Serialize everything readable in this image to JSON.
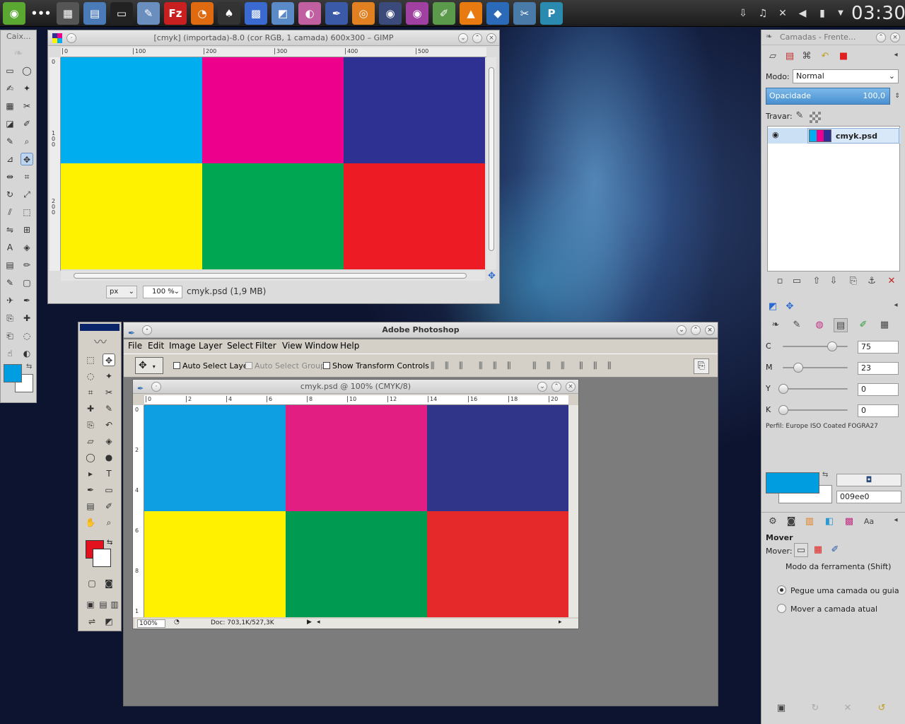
{
  "topbar": {
    "clock": "03:30",
    "launchers": [
      {
        "name": "opensuse-icon",
        "glyph": "◉",
        "color": "#5aa832"
      },
      {
        "name": "dots-icon",
        "glyph": "•••",
        "color": "transparent"
      },
      {
        "name": "window-switcher-icon",
        "glyph": "▦",
        "color": "#555"
      },
      {
        "name": "clipboard-icon",
        "glyph": "▤",
        "color": "#4a7ab8"
      },
      {
        "name": "terminal-icon",
        "glyph": "▭",
        "color": "#222"
      },
      {
        "name": "text-editor-icon",
        "glyph": "✎",
        "color": "#6a8fbf"
      },
      {
        "name": "filezilla-icon",
        "glyph": "Fz",
        "color": "#c82020"
      },
      {
        "name": "firefox-icon",
        "glyph": "◔",
        "color": "#e06a10"
      },
      {
        "name": "inkscape-icon",
        "glyph": "♠",
        "color": "#333"
      },
      {
        "name": "color-grid-icon",
        "glyph": "▩",
        "color": "#3a6ad0"
      },
      {
        "name": "image-viewer-icon",
        "glyph": "◩",
        "color": "#5a8ac8"
      },
      {
        "name": "paint-icon",
        "glyph": "◐",
        "color": "#c060a0"
      },
      {
        "name": "draw-icon",
        "glyph": "✒",
        "color": "#3a5aa8"
      },
      {
        "name": "blender-icon",
        "glyph": "◎",
        "color": "#e08020"
      },
      {
        "name": "camera-icon",
        "glyph": "◉",
        "color": "#3a4a7a"
      },
      {
        "name": "eye-icon",
        "glyph": "◉",
        "color": "#a040a0"
      },
      {
        "name": "pen-icon",
        "glyph": "✐",
        "color": "#5a9a4a"
      },
      {
        "name": "vlc-icon",
        "glyph": "▲",
        "color": "#e87a10"
      },
      {
        "name": "navigator-icon",
        "glyph": "◆",
        "color": "#2a6ab8"
      },
      {
        "name": "tools-icon",
        "glyph": "✂",
        "color": "#4a7aa8"
      },
      {
        "name": "photoshop-icon",
        "glyph": "P",
        "color": "#2a8ab0"
      }
    ],
    "tray": [
      "download-icon",
      "music-icon",
      "network-icon",
      "volume-icon",
      "battery-icon",
      "chevron-down-icon"
    ]
  },
  "gimp_toolbox": {
    "title": "Caix..."
  },
  "gimp_image": {
    "title": "[cmyk] (importada)-8.0 (cor RGB, 1 camada) 600x300 – GIMP",
    "ruler_ticks": [
      "0",
      "100",
      "200",
      "300",
      "400",
      "500"
    ],
    "unit": "px",
    "zoom": "100 %",
    "status": "cmyk.psd (1,9 MB)",
    "colors": [
      "#00aeef",
      "#ec008c",
      "#2e3192",
      "#fff200",
      "#00a651",
      "#ed1c24"
    ]
  },
  "photoshop": {
    "title": "Adobe Photoshop",
    "menu": [
      "File",
      "Edit",
      "Image",
      "Layer",
      "Select",
      "Filter",
      "View",
      "Window",
      "Help"
    ],
    "options": {
      "auto_select_layer": "Auto Select Layer",
      "auto_select_groups": "Auto Select Groups",
      "show_transform_controls": "Show Transform Controls"
    },
    "doc": {
      "title": "cmyk.psd @ 100% (CMYK/8)",
      "ruler_ticks": [
        "0",
        "2",
        "4",
        "6",
        "8",
        "10",
        "12",
        "14",
        "16",
        "18",
        "20"
      ],
      "v_ticks": [
        "0",
        "2",
        "4",
        "6",
        "8",
        "1"
      ],
      "zoom": "100%",
      "doc_size": "Doc: 703,1K/527,3K",
      "colors": [
        "#0d9fe2",
        "#e31e82",
        "#303589",
        "#fff100",
        "#009a51",
        "#e5282a"
      ]
    },
    "fg_color": "#e3101e"
  },
  "layers_dock": {
    "title": "Camadas - Frente...",
    "mode_label": "Modo:",
    "mode_value": "Normal",
    "opacity_label": "Opacidade",
    "opacity_value": "100,0",
    "lock_label": "Travar:",
    "layer_name": "cmyk.psd"
  },
  "color_dock": {
    "channels": [
      {
        "label": "C",
        "value": "75",
        "fraction": 0.75
      },
      {
        "label": "M",
        "value": "23",
        "fraction": 0.23
      },
      {
        "label": "Y",
        "value": "0",
        "fraction": 0
      },
      {
        "label": "K",
        "value": "0",
        "fraction": 0
      }
    ],
    "profile": "Perfil: Europe ISO Coated FOGRA27",
    "hex": "009ee0",
    "fg_color": "#009ee0"
  },
  "tool_options": {
    "title": "Mover",
    "move_label": "Mover:",
    "mode_hint": "Modo da ferramenta (Shift)",
    "option1": "Pegue uma camada ou guia",
    "option2": "Mover a camada atual"
  }
}
